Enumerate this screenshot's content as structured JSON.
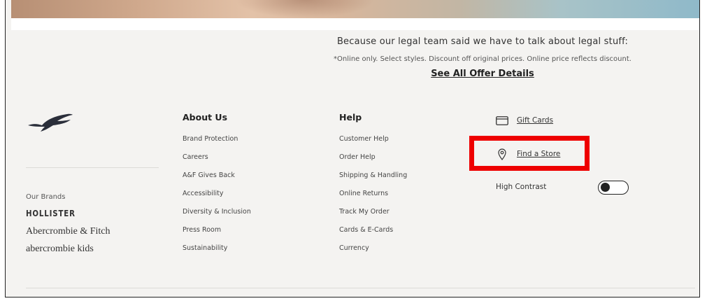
{
  "legal": {
    "heading": "Because our legal team said we have to talk about legal stuff:",
    "text": "*Online only. Select styles. Discount off original prices. Online price reflects discount.",
    "link": "See All Offer Details"
  },
  "brands": {
    "label": "Our Brands",
    "items": [
      "HOLLISTER",
      "Abercrombie & Fitch",
      "abercrombie kids"
    ]
  },
  "about": {
    "title": "About Us",
    "items": [
      "Brand Protection",
      "Careers",
      "A&F Gives Back",
      "Accessibility",
      "Diversity & Inclusion",
      "Press Room",
      "Sustainability"
    ]
  },
  "help": {
    "title": "Help",
    "items": [
      "Customer Help",
      "Order Help",
      "Shipping & Handling",
      "Online Returns",
      "Track My Order",
      "Cards & E-Cards",
      "Currency"
    ]
  },
  "links": {
    "gift_cards": "Gift Cards",
    "find_store": "Find a Store",
    "high_contrast": "High Contrast"
  },
  "icons": {
    "logo": "hollister-seagull-logo",
    "gift": "credit-card-icon",
    "store": "map-pin-icon"
  },
  "colors": {
    "highlight": "#ee0000",
    "background": "#f4f3f1"
  }
}
